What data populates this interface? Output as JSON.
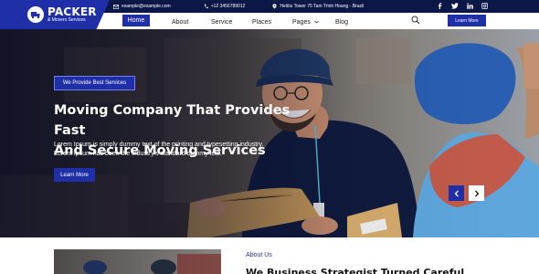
{
  "brand": {
    "name": "PACKER",
    "tagline": "& Movers Services",
    "accent_color": "#1f2fa8",
    "topbar_color": "#0b1747"
  },
  "topbar": {
    "email": "example@example.com",
    "phone": "+12 3456789012",
    "address": "Heliös Tower 75 Tam Trinh Hoang - Brazil",
    "socials": [
      "facebook-icon",
      "twitter-icon",
      "linkedin-icon",
      "instagram-icon"
    ]
  },
  "nav": {
    "items": [
      {
        "label": "Home",
        "active": true
      },
      {
        "label": "About"
      },
      {
        "label": "Service"
      },
      {
        "label": "Places"
      },
      {
        "label": "Pages",
        "has_dropdown": true
      },
      {
        "label": "Blog"
      }
    ],
    "cta": "Learn More"
  },
  "hero": {
    "badge": "We Provide Best Services",
    "title_line1": "Moving Company That Provides Fast",
    "title_line2": "And Secure Moving Services",
    "desc_line1": "Lorem Ipsum is simply dummy text of the printing and typesetting industry.",
    "desc_line2": "Lorem Ipsum has been the industry's standard dummy text.",
    "button": "Learn More"
  },
  "about": {
    "label": "About Us",
    "heading": "We Business Strategist Turned Careful"
  }
}
